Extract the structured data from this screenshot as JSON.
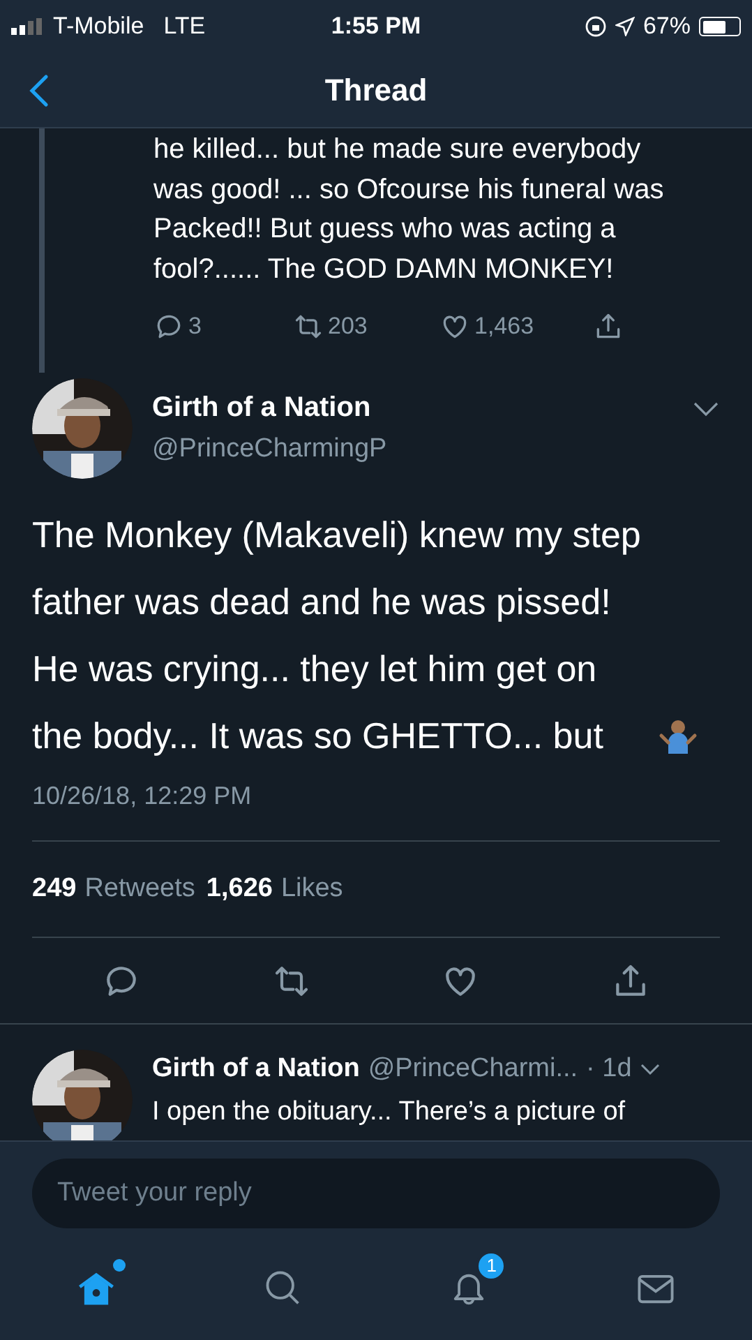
{
  "status_bar": {
    "carrier": "T-Mobile",
    "network": "LTE",
    "time": "1:55 PM",
    "battery": "67%"
  },
  "nav": {
    "title": "Thread"
  },
  "parent_tweet": {
    "text": "he killed... but he made sure everybody was good! ... so Ofcourse his funeral was Packed!! But guess who was acting a fool?...... The GOD DAMN MONKEY!",
    "replies": "3",
    "retweets": "203",
    "likes": "1,463"
  },
  "main_tweet": {
    "name": "Girth of a Nation",
    "handle": "@PrinceCharmingP",
    "text": "The Monkey (Makaveli) knew my step father was dead and he was pissed! He was crying... they let him get on the body... It was so GHETTO... but",
    "timestamp": "10/26/18, 12:29 PM",
    "retweets_count": "249",
    "retweets_label": "Retweets",
    "likes_count": "1,626",
    "likes_label": "Likes"
  },
  "reply_tweet": {
    "name": "Girth of a Nation",
    "handle": "@PrinceCharmi...",
    "time": "· 1d",
    "text": "I open the obituary... There’s a picture of"
  },
  "compose": {
    "placeholder": "Tweet your reply"
  },
  "tab_bar": [
    {
      "kind": "home",
      "selected": true,
      "dot": true
    },
    {
      "kind": "search",
      "selected": false
    },
    {
      "kind": "notifications",
      "selected": false,
      "badge": "1"
    },
    {
      "kind": "messages",
      "selected": false
    }
  ]
}
